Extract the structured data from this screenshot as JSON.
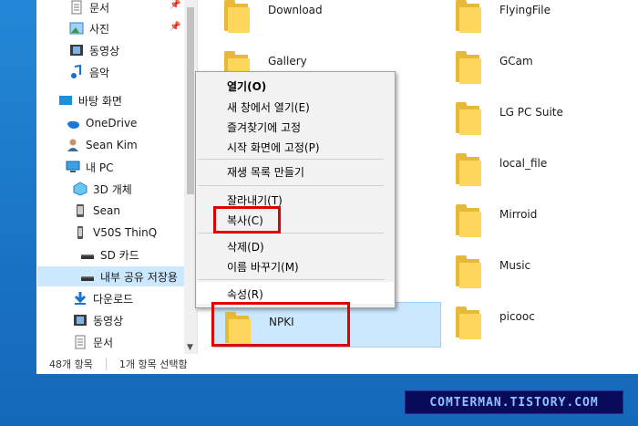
{
  "sidebar": {
    "items": [
      {
        "label": "문서",
        "icon": "document-icon",
        "pinned": true
      },
      {
        "label": "사진",
        "icon": "pictures-icon",
        "pinned": true
      },
      {
        "label": "동영상",
        "icon": "videos-icon"
      },
      {
        "label": "음악",
        "icon": "music-icon"
      },
      {
        "label": "바탕 화면",
        "icon": "desktop-icon"
      },
      {
        "label": "OneDrive",
        "icon": "onedrive-icon"
      },
      {
        "label": "Sean Kim",
        "icon": "user-icon"
      },
      {
        "label": "내 PC",
        "icon": "this-pc-icon"
      },
      {
        "label": "3D 개체",
        "icon": "3d-objects-icon"
      },
      {
        "label": "Sean",
        "icon": "phone-icon"
      },
      {
        "label": "V50S ThinQ",
        "icon": "phone-icon"
      },
      {
        "label": "SD 카드",
        "icon": "drive-icon"
      },
      {
        "label": "내부 공유 저장용",
        "icon": "drive-icon",
        "selected": true
      },
      {
        "label": "다운로드",
        "icon": "download-icon"
      },
      {
        "label": "동영상",
        "icon": "videos-icon"
      },
      {
        "label": "문서",
        "icon": "document-icon"
      }
    ]
  },
  "folders": {
    "col1": [
      "Download",
      "Gallery",
      "",
      "",
      "",
      "",
      "",
      "NPKI"
    ],
    "col2": [
      "FlyingFile",
      "GCam",
      "LG PC Suite",
      "local_file",
      "Mirroid",
      "Music",
      "picooc"
    ]
  },
  "context_menu": {
    "items": [
      "열기(O)",
      "새 창에서 열기(E)",
      "즐겨찾기에 고정",
      "시작 화면에 고정(P)",
      "재생 목록 만들기",
      "잘라내기(T)",
      "복사(C)",
      "삭제(D)",
      "이름 바꾸기(M)",
      "속성(R)"
    ]
  },
  "status": {
    "count": "48개 항목",
    "selected": "1개 항목 선택함"
  },
  "watermark": "COMTERMAN.TISTORY.COM",
  "colors": {
    "selection": "#cce8ff",
    "highlight_box": "#e00000",
    "folder": "#ffd65c"
  }
}
